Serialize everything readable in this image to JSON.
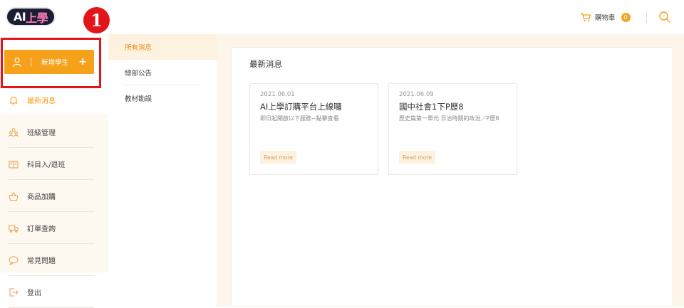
{
  "brand": {
    "logo_part1": "AI",
    "logo_part2": "上學",
    "accent": "#f5a11a",
    "highlight_frame": "#e3141a"
  },
  "annotation": {
    "step_number": "1"
  },
  "header": {
    "cart_label": "購物車",
    "cart_count": "0",
    "icons": [
      "cart-icon",
      "search-icon"
    ]
  },
  "sidebar": {
    "add_student_label": "新增學生",
    "add_student_plus": "+",
    "items": [
      {
        "label": "最新消息",
        "icon": "bell-icon",
        "active": true
      },
      {
        "label": "班級管理",
        "icon": "group-icon",
        "active": false
      },
      {
        "label": "科目入/退班",
        "icon": "book-icon",
        "active": false
      },
      {
        "label": "商品加購",
        "icon": "basket-icon",
        "active": false
      },
      {
        "label": "訂單查詢",
        "icon": "truck-icon",
        "active": false
      },
      {
        "label": "常見問題",
        "icon": "chat-icon",
        "active": false
      },
      {
        "label": "登出",
        "icon": "logout-icon",
        "active": false
      }
    ]
  },
  "subnav": {
    "items": [
      {
        "label": "所有消息",
        "active": true
      },
      {
        "label": "總部公告",
        "active": false
      },
      {
        "label": "教材勘誤",
        "active": false
      }
    ]
  },
  "main": {
    "title": "最新消息",
    "cards": [
      {
        "date": "2021.06.01",
        "title": "AI上學訂購平台上線囉",
        "desc": "即日起開啟以下服務~點擊查看",
        "more": "Read more"
      },
      {
        "date": "2021.06.09",
        "title": "國中社會1下P歷8",
        "desc": "歷史篇第一單元 日治時期的政治／P歷8",
        "more": "Read more"
      }
    ]
  }
}
